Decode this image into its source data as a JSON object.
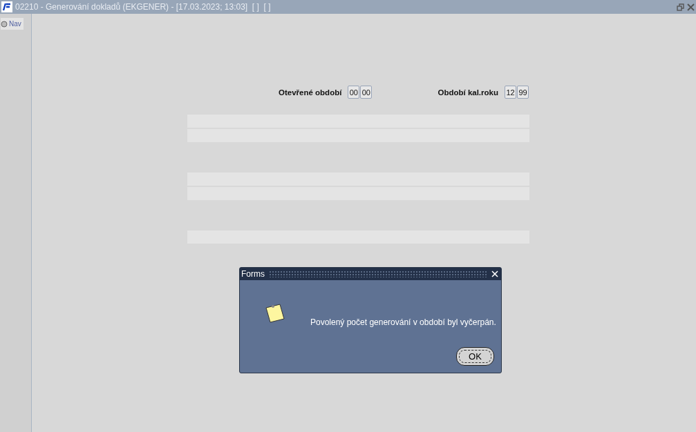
{
  "window": {
    "title": "02210 - Generování dokladů (EKGENER) - [17.03.2023; 13:03]  [ ]  [ ]"
  },
  "sidebar": {
    "items": [
      {
        "label": "Nav",
        "selected": false
      }
    ]
  },
  "periods": [
    {
      "label": "Otevřené období",
      "values": [
        "00",
        "00"
      ]
    },
    {
      "label": "Období kal.roku",
      "values": [
        "12",
        "99"
      ]
    }
  ],
  "dialog": {
    "title": "Forms",
    "message": "Povolený počet generování v období byl vyčerpán.",
    "buttons": [
      "OK"
    ]
  }
}
